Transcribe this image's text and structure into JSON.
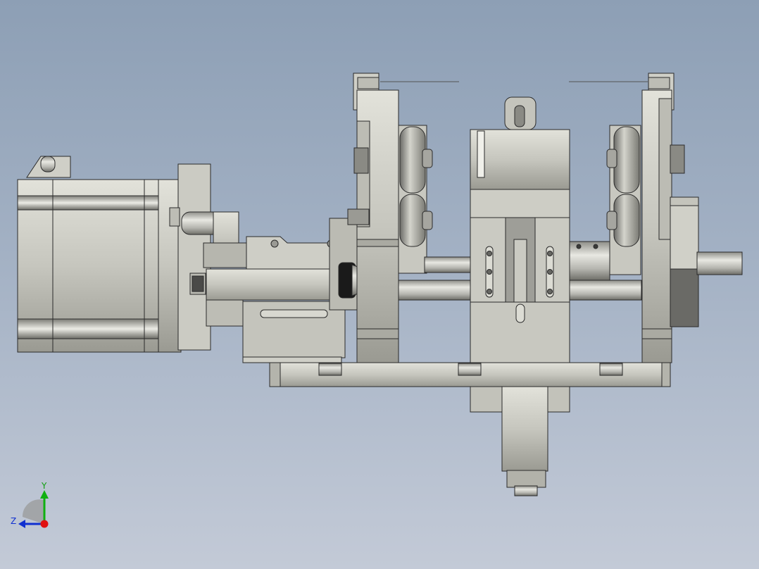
{
  "viewport": {
    "background_top": "#8d9fb5",
    "background_bottom": "#c3cad7",
    "part_fill": "#c8c8c0",
    "part_edge": "#2a2a2a",
    "dark_fill": "#555552"
  },
  "triad": {
    "y_label": "Y",
    "z_label": "Z",
    "x_color": "#e01010",
    "y_color": "#10b010",
    "z_color": "#1030d0"
  }
}
